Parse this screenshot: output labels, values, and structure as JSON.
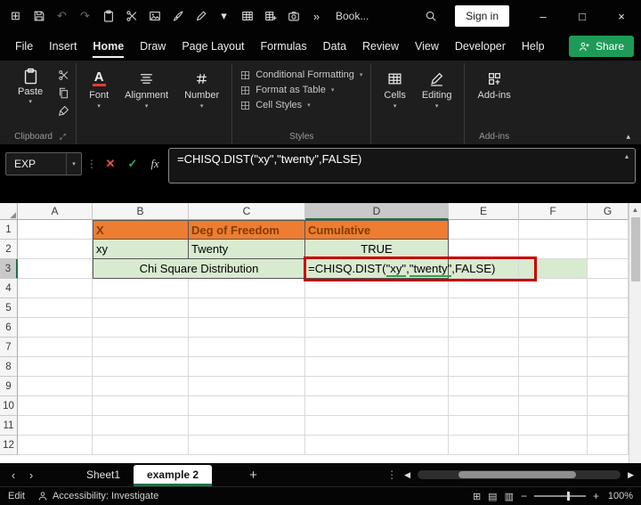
{
  "colors": {
    "share_green": "#1E9B57",
    "orange_fill": "#ED7D31",
    "orange_text": "#833C00",
    "green_fill": "#D8EACF",
    "red_box": "#C80000",
    "header_selected": "#C9C9C9"
  },
  "titlebar": {
    "icons": [
      {
        "name": "app-launcher-icon",
        "glyph": "⊞"
      },
      {
        "name": "save-icon"
      },
      {
        "name": "undo-icon",
        "glyph": "↶",
        "disabled": true
      },
      {
        "name": "redo-icon",
        "glyph": "↷",
        "disabled": true
      },
      {
        "name": "clipboard-icon"
      },
      {
        "name": "cut-icon"
      },
      {
        "name": "image-icon"
      },
      {
        "name": "paint-brush-icon"
      },
      {
        "name": "pen-icon"
      },
      {
        "name": "chevron-down-icon",
        "glyph": "▾"
      },
      {
        "name": "table-icon"
      },
      {
        "name": "add-table-icon"
      },
      {
        "name": "camera-icon"
      },
      {
        "name": "more-commands-icon",
        "glyph": "»"
      }
    ],
    "document_name": "Book...",
    "sign_in_label": "Sign in",
    "window_controls": {
      "minimize": "–",
      "maximize": "□",
      "close": "×"
    }
  },
  "menubar": {
    "items": [
      "File",
      "Insert",
      "Home",
      "Draw",
      "Page Layout",
      "Formulas",
      "Data",
      "Review",
      "View",
      "Developer",
      "Help"
    ],
    "active_item": "Home",
    "share_label": "Share"
  },
  "ribbon": {
    "clipboard": {
      "paste_label": "Paste",
      "group_label": "Clipboard",
      "small_icons": [
        "cut-icon",
        "copy-icon",
        "format-painter-icon"
      ]
    },
    "collapsed_left": [
      {
        "label": "Font",
        "icon": "font-icon"
      },
      {
        "label": "Alignment",
        "icon": "alignment-icon"
      },
      {
        "label": "Number",
        "icon": "number-icon"
      }
    ],
    "styles": {
      "group_label": "Styles",
      "items": [
        "Conditional Formatting",
        "Format as Table",
        "Cell Styles"
      ]
    },
    "collapsed_right": [
      {
        "label": "Cells",
        "icon": "cells-icon"
      },
      {
        "label": "Editing",
        "icon": "editing-icon"
      }
    ],
    "addins": {
      "label": "Add-ins",
      "group_label": "Add-ins"
    },
    "collapse_glyph": "▴"
  },
  "formula_bar": {
    "name_box_value": "EXP",
    "cancel_glyph": "✕",
    "enter_glyph": "✓",
    "fx_label": "fx",
    "formula": "=CHISQ.DIST(\"xy\",\"twenty\",FALSE)",
    "collapse_glyph": "▴"
  },
  "grid": {
    "column_headers": [
      "A",
      "B",
      "C",
      "D",
      "E",
      "F",
      "G"
    ],
    "row_headers": [
      "1",
      "2",
      "3",
      "4",
      "5",
      "6",
      "7",
      "8",
      "9",
      "10",
      "11",
      "12"
    ],
    "selected_column": "D",
    "selected_row": "3",
    "select_all_glyph": "◢",
    "cells": [
      {
        "ref": "B1",
        "text": "X",
        "style": "orange tbl"
      },
      {
        "ref": "C1",
        "text": "Deg of Freedom",
        "style": "orange tbl"
      },
      {
        "ref": "D1",
        "text": "Cumulative",
        "style": "orange tbl"
      },
      {
        "ref": "B2",
        "text": "xy",
        "style": "green tbl"
      },
      {
        "ref": "C2",
        "text": "Twenty",
        "style": "green tbl"
      },
      {
        "ref": "D2",
        "text": "TRUE",
        "style": "green tbl",
        "align": "center"
      },
      {
        "ref": "B3",
        "text": "Chi Square Distribution",
        "style": "green tbl",
        "merge_cols": 2,
        "align": "center"
      },
      {
        "ref": "D3",
        "text": "",
        "style": "green tbl formula-cell"
      },
      {
        "ref": "E3",
        "text": "",
        "style": "green"
      },
      {
        "ref": "F3",
        "text": "",
        "style": "green"
      }
    ],
    "formula_cell": {
      "ref": "D3",
      "parts": [
        {
          "text": "=CHISQ.DIST(",
          "underline": false
        },
        {
          "text": "\"xy\"",
          "underline": true
        },
        {
          "text": ",",
          "underline": false
        },
        {
          "text": "\"twenty\"",
          "underline": true
        },
        {
          "text": ",FALSE)",
          "underline": false
        }
      ]
    }
  },
  "sheet_tabs": {
    "nav_left": "‹",
    "nav_right": "›",
    "tabs": [
      {
        "label": "Sheet1",
        "active": false
      },
      {
        "label": "example 2",
        "active": true
      }
    ],
    "add_label": "+",
    "dots_glyph": "⋮",
    "scroll_left": "◀",
    "scroll_right": "▶"
  },
  "status_bar": {
    "mode": "Edit",
    "accessibility_label": "Accessibility: Investigate",
    "view_icons": [
      "⊞",
      "▤",
      "▥"
    ],
    "zoom_minus": "−",
    "zoom_plus": "+",
    "zoom_level": "100%"
  }
}
